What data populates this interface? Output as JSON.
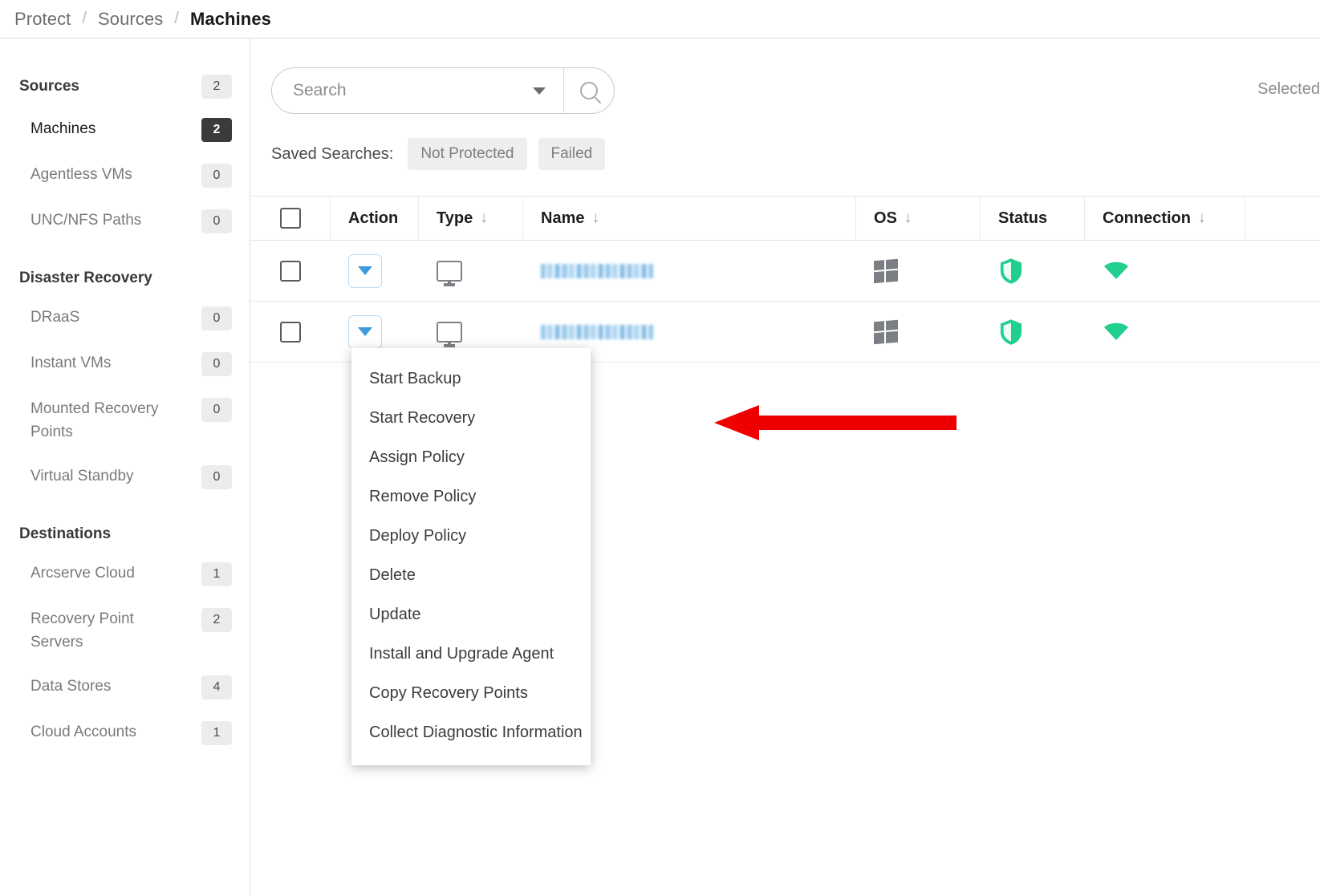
{
  "breadcrumb": {
    "items": [
      "Protect",
      "Sources",
      "Machines"
    ],
    "separator": "/"
  },
  "sidebar": {
    "groups": [
      {
        "title": "Sources",
        "count": "2",
        "items": [
          {
            "label": "Machines",
            "count": "2",
            "selected": true
          },
          {
            "label": "Agentless VMs",
            "count": "0",
            "selected": false
          },
          {
            "label": "UNC/NFS Paths",
            "count": "0",
            "selected": false
          }
        ]
      },
      {
        "title": "Disaster Recovery",
        "count": "",
        "items": [
          {
            "label": "DRaaS",
            "count": "0",
            "selected": false
          },
          {
            "label": "Instant VMs",
            "count": "0",
            "selected": false
          },
          {
            "label": "Mounted Recovery Points",
            "count": "0",
            "selected": false
          },
          {
            "label": "Virtual Standby",
            "count": "0",
            "selected": false
          }
        ]
      },
      {
        "title": "Destinations",
        "count": "",
        "items": [
          {
            "label": "Arcserve Cloud",
            "count": "1",
            "selected": false
          },
          {
            "label": "Recovery Point Servers",
            "count": "2",
            "selected": false
          },
          {
            "label": "Data Stores",
            "count": "4",
            "selected": false
          },
          {
            "label": "Cloud Accounts",
            "count": "1",
            "selected": false
          }
        ]
      }
    ]
  },
  "search": {
    "value": "",
    "placeholder": "Search",
    "dropdown_icon": "chevron-down-icon",
    "submit_icon": "search-icon"
  },
  "toolbar": {
    "selected_label": "Selected"
  },
  "saved_searches": {
    "label": "Saved Searches:",
    "chips": [
      "Not Protected",
      "Failed"
    ]
  },
  "table": {
    "columns": [
      {
        "label": "",
        "sortable": false,
        "key": "check"
      },
      {
        "label": "Action",
        "sortable": false,
        "key": "action"
      },
      {
        "label": "Type",
        "sortable": true,
        "key": "type"
      },
      {
        "label": "Name",
        "sortable": true,
        "key": "name"
      },
      {
        "label": "OS",
        "sortable": true,
        "key": "os"
      },
      {
        "label": "Status",
        "sortable": false,
        "key": "status"
      },
      {
        "label": "Connection",
        "sortable": true,
        "key": "connection"
      }
    ],
    "sort_glyph": "↓",
    "rows": [
      {
        "checked": false,
        "action_icon": "caret-down-icon",
        "type_icon": "monitor-icon",
        "name": "",
        "name_redacted": true,
        "os_icon": "windows-icon",
        "status_icon": "shield-protected-icon",
        "connection_icon": "wifi-connected-icon"
      },
      {
        "checked": false,
        "action_icon": "caret-down-icon",
        "type_icon": "monitor-icon",
        "name": "",
        "name_redacted": true,
        "os_icon": "windows-icon",
        "status_icon": "shield-protected-icon",
        "connection_icon": "wifi-connected-icon"
      }
    ]
  },
  "action_menu": {
    "open": true,
    "items": [
      "Start Backup",
      "Start Recovery",
      "Assign Policy",
      "Remove Policy",
      "Deploy Policy",
      "Delete",
      "Update",
      "Install and Upgrade Agent",
      "Copy Recovery Points",
      "Collect Diagnostic Information"
    ]
  },
  "annotation": {
    "arrow_color": "#ee0000",
    "points_to": "Start Backup"
  },
  "colors": {
    "status_green": "#21cf8e",
    "accent_blue": "#3d9bdc",
    "selected_badge": "#3b3b3b",
    "badge_grey": "#ececec",
    "annotation_red": "#ee0000"
  }
}
